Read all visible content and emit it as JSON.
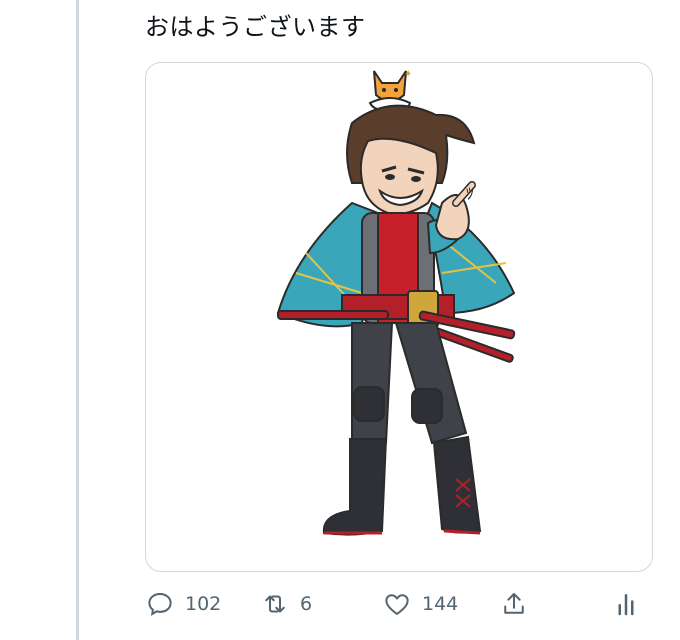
{
  "tweet": {
    "text": "おはようございます"
  },
  "media": {
    "alt": "",
    "reaction_marks": "ﾂ"
  },
  "actions": {
    "reply_count": "102",
    "retweet_count": "6",
    "like_count": "144"
  },
  "colors": {
    "icon": "#536471",
    "border": "#cfd9de",
    "text": "#0f1419"
  }
}
